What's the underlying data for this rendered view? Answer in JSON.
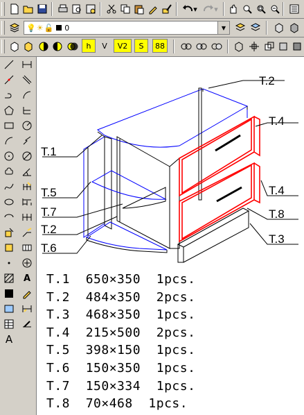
{
  "toolbar_row1": {
    "icons": [
      "new-icon",
      "open-icon",
      "save-icon",
      "print-icon",
      "plot-preview-icon",
      "publish-icon",
      "cut-icon",
      "copy-icon",
      "paste-icon",
      "match-properties-icon",
      "block-editor-icon",
      "undo-icon",
      "redo-icon",
      "pan-icon",
      "zoom-realtime-icon",
      "zoom-window-icon",
      "properties-icon"
    ]
  },
  "toolbar_row2": {
    "layer_value": "0",
    "icons": [
      "layer-properties-icon",
      "lightbulb-icon",
      "sun-icon",
      "unlock-icon",
      "color-square-icon",
      "make-current-icon",
      "layer-previous-icon",
      "3d-box-icon"
    ]
  },
  "toolbar_row3": {
    "labels": [
      "h",
      "V",
      "V2",
      "S",
      "88"
    ]
  },
  "parts_list": [
    {
      "id": "T.1",
      "size": "650×350",
      "qty": "1pcs."
    },
    {
      "id": "T.2",
      "size": "484×350",
      "qty": "2pcs."
    },
    {
      "id": "T.3",
      "size": "468×350",
      "qty": "1pcs."
    },
    {
      "id": "T.4",
      "size": "215×500",
      "qty": "2pcs."
    },
    {
      "id": "T.5",
      "size": "398×150",
      "qty": "1pcs."
    },
    {
      "id": "T.6",
      "size": "150×350",
      "qty": "1pcs."
    },
    {
      "id": "T.7",
      "size": "150×334",
      "qty": "1pcs."
    },
    {
      "id": "T.8",
      "size": "70×468",
      "qty": "1pcs."
    }
  ],
  "drawing_labels": {
    "t2_top": "T.2",
    "t4_top": "T.4",
    "t1": "T.1",
    "t5": "T.5",
    "t4_bottom": "T.4",
    "t7": "T.7",
    "t8": "T.8",
    "t2_left": "T.2",
    "t3": "T.3",
    "t6": "T.6"
  },
  "colors": {
    "chrome": "#d4d0c8",
    "panel_blue": "#0000ff",
    "drawer_red": "#ff0000",
    "canvas": "#ffffff"
  }
}
